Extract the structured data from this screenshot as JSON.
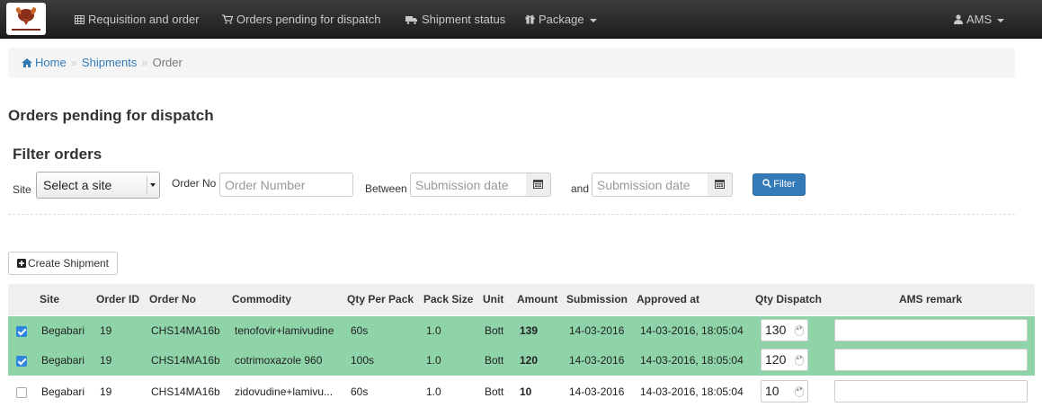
{
  "navbar": {
    "items": [
      {
        "label": "Requisition and order",
        "icon": "table-icon"
      },
      {
        "label": "Orders pending for dispatch",
        "icon": "cart-icon"
      },
      {
        "label": "Shipment status",
        "icon": "truck-icon"
      },
      {
        "label": "Package",
        "icon": "gift-icon"
      }
    ],
    "user": "AMS"
  },
  "breadcrumb": {
    "home": "Home",
    "shipments": "Shipments",
    "current": "Order"
  },
  "page_title": "Orders pending for dispatch",
  "filter": {
    "title": "Filter orders",
    "site_label": "Site",
    "site_selected": "Select a site",
    "order_no_label": "Order No",
    "order_no_placeholder": "Order Number",
    "between_label": "Between",
    "and_label": "and",
    "date_placeholder": "Submission date",
    "filter_button": "Filter"
  },
  "create_shipment": "Create Shipment",
  "table": {
    "headers": [
      "Site",
      "Order ID",
      "Order No",
      "Commodity",
      "Qty Per Pack",
      "Pack Size",
      "Unit",
      "Amount",
      "Submission",
      "Approved at",
      "Qty Dispatch",
      "AMS remark"
    ],
    "rows": [
      {
        "selected": true,
        "site": "Begabari",
        "order_id": "19",
        "order_no": "CHS14MA16b",
        "commodity": "tenofovir+lamivudine",
        "qty_per_pack": "60s",
        "pack_size": "1.0",
        "unit": "Bott",
        "amount": "139",
        "submission": "14-03-2016",
        "approved_at": "14-03-2016, 18:05:04",
        "qty_dispatch": "130"
      },
      {
        "selected": true,
        "site": "Begabari",
        "order_id": "19",
        "order_no": "CHS14MA16b",
        "commodity": "cotrimoxazole 960",
        "qty_per_pack": "100s",
        "pack_size": "1.0",
        "unit": "Bott",
        "amount": "120",
        "submission": "14-03-2016",
        "approved_at": "14-03-2016, 18:05:04",
        "qty_dispatch": "120"
      },
      {
        "selected": false,
        "site": "Begabari",
        "order_id": "19",
        "order_no": "CHS14MA16b",
        "commodity": "zidovudine+lamivu...",
        "qty_per_pack": "60s",
        "pack_size": "1.0",
        "unit": "Bott",
        "amount": "10",
        "submission": "14-03-2016",
        "approved_at": "14-03-2016, 18:05:04",
        "qty_dispatch": "10"
      }
    ]
  },
  "colors": {
    "selected_row": "#8ed4a8",
    "primary": "#337ab7",
    "navbar": "#222222"
  }
}
